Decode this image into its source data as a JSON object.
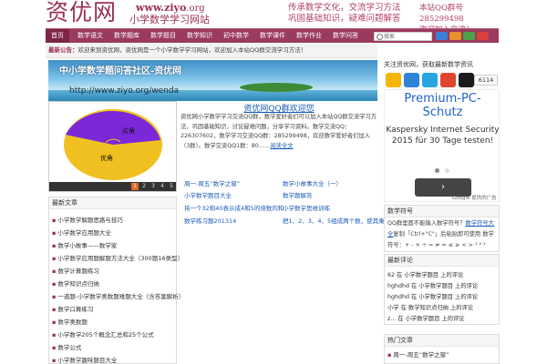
{
  "header": {
    "logo": "资优网",
    "url_main": "www.ziyo",
    "url_tld": ".org",
    "subtitle": "小学数学学习网站",
    "slogan_line1": "传承数学文化，交流学习方法",
    "slogan_line2": "巩固基础知识，疑难问题解答",
    "contact_line1": "本站QQ群号285299498",
    "contact_line2": "欢迎加入交流！"
  },
  "nav": {
    "home": "首页",
    "items": [
      "数学语文",
      "数学题库",
      "数学题目",
      "数学知识",
      "初中数学",
      "数学课件",
      "数学作业",
      "数学问答"
    ],
    "search_placeholder": "搜索"
  },
  "ticker": {
    "label": "最新公告：",
    "text": "欢迎来到资优网，资优网是一个小学数学学习网站，欢迎加入本站QQ群交流学习方法！"
  },
  "banner": {
    "title": "中小学数学题问答社区-资优网",
    "url": "http://www.ziyo.org/wenda"
  },
  "slider": {
    "pie_labels": [
      "劣角",
      "优角"
    ],
    "pages": [
      "1",
      "2",
      "3",
      "4",
      "5"
    ],
    "active": 1
  },
  "featured": {
    "title": "资优网QQ群欢迎您",
    "text": "资优网小学数学学习交流QQ群，数学爱好者们可以加入本站QQ群交流学习方法，巩固基础知识，讨论疑难问题，分享学习资料。数学交流QQ：226307602，数学学习交流QQ群：285299498，欢迎数学爱好者们加入（3群）。数学交流QQ1群：80……",
    "more": "阅读全文"
  },
  "links": [
    "周一-周五“数学之窗”",
    "数学小故事大全（一）",
    "小学数学题目大全",
    "数学题解答",
    "将一个32和40表示成4和5的倍数的和",
    "小学数学思维训练",
    "数学练习题201314",
    "把1、2、3、4、5组成两个数，使其乘积最大"
  ],
  "left_box": {
    "title": "最新文章",
    "items": [
      "小学数学解题思路与技巧",
      "小学数学应用题大全",
      "数学小故事——数学家",
      "小学数学应用题解题方法大全（300题16类型）",
      "数学计算题练习",
      "数学知识点归纳",
      "一道题-小学数学奥数题难题大全（含答案解析）",
      "数学口算练习",
      "数学奥数题",
      "小学数学205个概念汇总和25个公式",
      "数学公式",
      "小学数学趣味题目大全",
      "从AB两地相距问题解析"
    ]
  },
  "sidebar": {
    "follow_title": "关注资优网，获取最新数学资讯",
    "follow_count": "6114",
    "ad": {
      "headline": "Premium-PC-Schutz",
      "text": "Kaspersky Internet Security 2015 für 30 Tage testen!",
      "button": "›",
      "by": "Google 提供的广告"
    },
    "box1_title": "数学符号",
    "box1_text_a": "QQ群里面不能输入数学符号？",
    "box1_link": "数学符号大全",
    "box1_text_b": "复制「Ctrl+\"C\"」后粘贴即可使用 数学符号：+ - × ÷ = ≠ ≈ ≤ ≥ < > ¹ ² ³",
    "box2_title": "最新评论",
    "comments": [
      "62 在 小学数学题目 上的评论",
      "hghdhd 在 小学数学题目 上的评论",
      "hghdhd 在 小学数学题目 上的评论",
      "小学 在 数学知识点归纳 上的评论",
      "z... 在 小学数学题目 上的评论"
    ],
    "box3_title": "热门文章",
    "box3_item": "周一-周五“数学之窗”"
  }
}
